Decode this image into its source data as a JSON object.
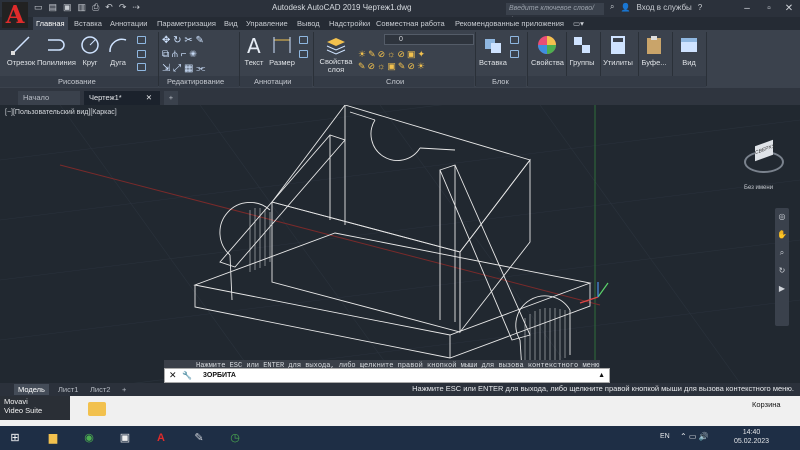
{
  "app": {
    "title": "Autodesk AutoCAD 2019    Чертеж1.dwg",
    "logo_letter": "A",
    "search_placeholder": "Введите ключевое слово/фразу",
    "signin": "Вход в службы",
    "qat_icons": [
      "new-icon",
      "open-icon",
      "save-icon",
      "saveas-icon",
      "print-icon",
      "undo-icon",
      "redo-icon",
      "share-icon"
    ]
  },
  "ribbon_tabs": [
    "Главная",
    "Вставка",
    "Аннотации",
    "Параметризация",
    "Вид",
    "Управление",
    "Вывод",
    "Надстройки",
    "Совместная работа",
    "Рекомендованные приложения"
  ],
  "ribbon": {
    "draw": {
      "otrezok": "Отрезок",
      "polyline": "Полилиния",
      "circle": "Круг",
      "arc": "Дуга",
      "panel": "Рисование"
    },
    "modify": {
      "panel": "Редактирование"
    },
    "annotation": {
      "text": "Текст",
      "dimension": "Размер",
      "panel": "Аннотации"
    },
    "layers": {
      "props": "Свойства слоя",
      "current_layer": "0",
      "panel": "Слои"
    },
    "block": {
      "insert": "Вставка",
      "panel": "Блок"
    },
    "properties": {
      "label": "Свойства"
    },
    "groups": {
      "label": "Группы"
    },
    "utilities": {
      "label": "Утилиты"
    },
    "clipboard": {
      "label": "Буфе..."
    },
    "view": {
      "label": "Вид"
    }
  },
  "file_tabs": [
    "Начало",
    "Чертеж1*"
  ],
  "viewport": {
    "label": "[−][Пользовательский вид][Каркас]",
    "viewcube_label": "Без имени",
    "cube_face": "СВЕРХУ"
  },
  "command": {
    "history": "Нажмите ESC или ENTER для выхода, либо щелкните правой кнопкой мыши для вызова контекстного меню.",
    "current": "3ОРБИТА"
  },
  "layout_tabs": [
    "Модель",
    "Лист1",
    "Лист2"
  ],
  "status_message": "Нажмите ESC или ENTER для выхода, либо щелкните правой кнопкой мыши для вызова контекстного меню.",
  "desktop": {
    "movavi": "Movavi\nVideo Suite",
    "recycle": "Корзина"
  },
  "taskbar": {
    "lang": "EN",
    "time": "14:40",
    "date": "05.02.2023"
  },
  "colors": {
    "accent": "#e02b2b",
    "ribbon": "#3b424d",
    "viewport": "#212830"
  }
}
